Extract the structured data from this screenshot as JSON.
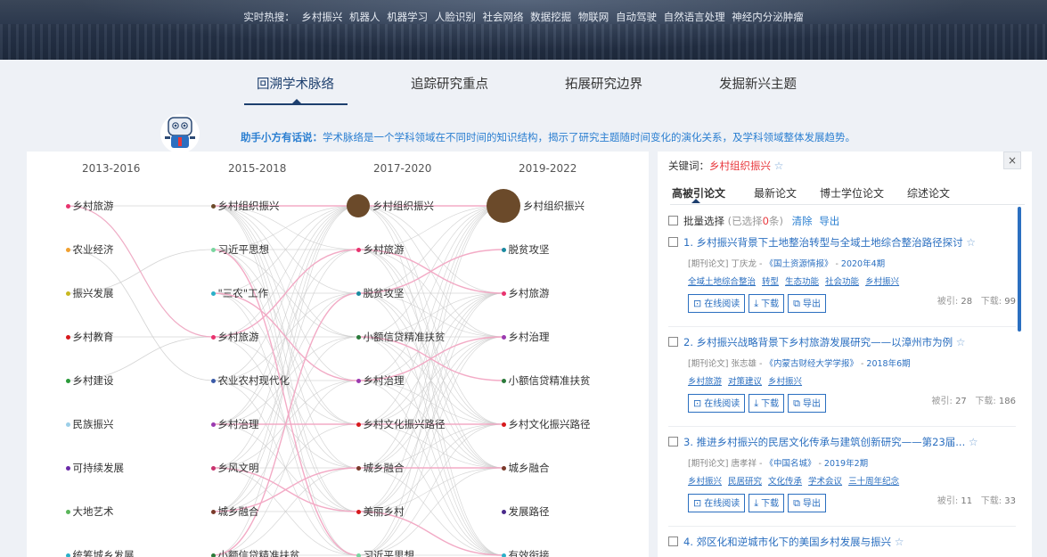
{
  "banner": {
    "hot_label": "实时热搜：",
    "hot_terms": [
      "乡村振兴",
      "机器人",
      "机器学习",
      "人脸识别",
      "社会网络",
      "数据挖掘",
      "物联网",
      "自动驾驶",
      "自然语言处理",
      "神经内分泌肿瘤"
    ]
  },
  "tabs": [
    {
      "label": "回溯学术脉络",
      "active": true
    },
    {
      "label": "追踪研究重点",
      "active": false
    },
    {
      "label": "拓展研究边界",
      "active": false
    },
    {
      "label": "发掘新兴主题",
      "active": false
    }
  ],
  "assistant": {
    "lead": "助手小方有话说：",
    "text": "学术脉络是一个学科领域在不同时间的知识结构，揭示了研究主题随时间变化的演化关系，及学科领域整体发展趋势。"
  },
  "graph": {
    "columns": [
      {
        "period": "2013-2016",
        "nodes": [
          {
            "label": "乡村旅游",
            "color": "#e8336e"
          },
          {
            "label": "农业经济",
            "color": "#f0a030"
          },
          {
            "label": "振兴发展",
            "color": "#c8b820"
          },
          {
            "label": "乡村教育",
            "color": "#d7191c"
          },
          {
            "label": "乡村建设",
            "color": "#2a9a3a"
          },
          {
            "label": "民族振兴",
            "color": "#9ccfe8"
          },
          {
            "label": "可持续发展",
            "color": "#6a2aa8"
          },
          {
            "label": "大地艺术",
            "color": "#5ab55a"
          },
          {
            "label": "统筹城乡发展",
            "color": "#2bb0c8"
          }
        ]
      },
      {
        "period": "2015-2018",
        "nodes": [
          {
            "label": "乡村组织振兴",
            "color": "#6b4a2a"
          },
          {
            "label": "习近平思想",
            "color": "#7ad6a0"
          },
          {
            "label": "\"三农\"工作",
            "color": "#2bb0c8"
          },
          {
            "label": "乡村旅游",
            "color": "#e8336e"
          },
          {
            "label": "农业农村现代化",
            "color": "#3a5aa8"
          },
          {
            "label": "乡村治理",
            "color": "#9a3ab0"
          },
          {
            "label": "乡风文明",
            "color": "#c8336e"
          },
          {
            "label": "城乡融合",
            "color": "#7a3a2a"
          },
          {
            "label": "小额信贷精准扶贫",
            "color": "#2a7a3a"
          }
        ]
      },
      {
        "period": "2017-2020",
        "nodes": [
          {
            "label": "乡村组织振兴",
            "color": "#6b4a2a"
          },
          {
            "label": "乡村旅游",
            "color": "#e8336e"
          },
          {
            "label": "脱贫攻坚",
            "color": "#1a8aa0"
          },
          {
            "label": "小额信贷精准扶贫",
            "color": "#2a7a3a"
          },
          {
            "label": "乡村治理",
            "color": "#9a3ab0"
          },
          {
            "label": "乡村文化振兴路径",
            "color": "#d7191c"
          },
          {
            "label": "城乡融合",
            "color": "#7a3a2a"
          },
          {
            "label": "美丽乡村",
            "color": "#d7191c"
          },
          {
            "label": "习近平思想",
            "color": "#7ad6a0"
          }
        ]
      },
      {
        "period": "2019-2022",
        "nodes": [
          {
            "label": "乡村组织振兴",
            "color": "#6b4a2a"
          },
          {
            "label": "脱贫攻坚",
            "color": "#1a8aa0"
          },
          {
            "label": "乡村旅游",
            "color": "#e8336e"
          },
          {
            "label": "乡村治理",
            "color": "#9a3ab0"
          },
          {
            "label": "小额信贷精准扶贫",
            "color": "#2a7a3a"
          },
          {
            "label": "乡村文化振兴路径",
            "color": "#d7191c"
          },
          {
            "label": "城乡融合",
            "color": "#7a3a2a"
          },
          {
            "label": "发展路径",
            "color": "#4a2a8a"
          },
          {
            "label": "有效衔接",
            "color": "#2bb0c8"
          }
        ]
      }
    ]
  },
  "panel": {
    "keyword_label": "关键词：",
    "keyword": "乡村组织振兴",
    "close": "×",
    "tabs": [
      "高被引论文",
      "最新论文",
      "博士学位论文",
      "综述论文"
    ],
    "batch": {
      "label": "批量选择",
      "selected": "(已选择",
      "count": "0",
      "unit": "条)",
      "clear": "清除",
      "export": "导出"
    },
    "papers": [
      {
        "title": "1. 乡村振兴背景下土地整治转型与全域土地综合整治路径探讨",
        "type": "[期刊论文]",
        "author": "丁庆龙",
        "source": "《国土资源情报》",
        "date": "2020年4期",
        "keywords": [
          "全域土地综合整治",
          "转型",
          "生态功能",
          "社会功能",
          "乡村振兴"
        ],
        "cited_label": "被引:",
        "cited": "28",
        "dl_label": "下载:",
        "downloads": "99"
      },
      {
        "title": "2. 乡村振兴战略背景下乡村旅游发展研究——以漳州市为例",
        "type": "[期刊论文]",
        "author": "张志雄",
        "source": "《内蒙古财经大学学报》",
        "date": "2018年6期",
        "keywords": [
          "乡村旅游",
          "对策建议",
          "乡村振兴"
        ],
        "cited_label": "被引:",
        "cited": "27",
        "dl_label": "下载:",
        "downloads": "186"
      },
      {
        "title": "3. 推进乡村振兴的民居文化传承与建筑创新研究——第23届...",
        "type": "[期刊论文]",
        "author": "唐孝祥",
        "source": "《中国名城》",
        "date": "2019年2期",
        "keywords": [
          "乡村振兴",
          "民居研究",
          "文化传承",
          "学术会议",
          "三十周年纪念"
        ],
        "cited_label": "被引:",
        "cited": "11",
        "dl_label": "下载:",
        "downloads": "33"
      },
      {
        "title": "4. 郊区化和逆城市化下的美国乡村发展与振兴"
      }
    ],
    "actions": {
      "read": "在线阅读",
      "download": "下载",
      "export": "导出"
    }
  }
}
